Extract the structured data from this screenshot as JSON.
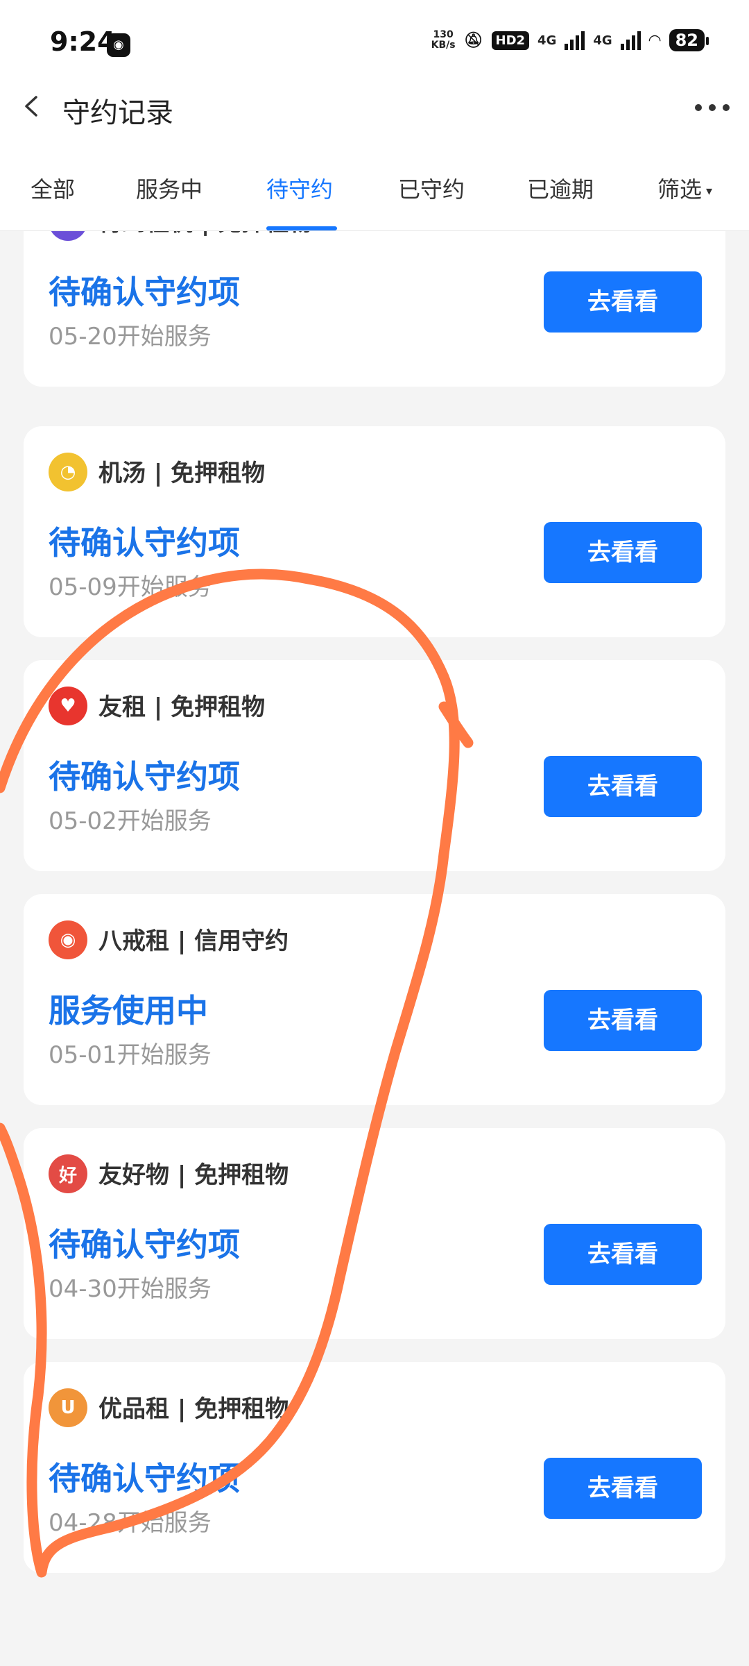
{
  "status_bar": {
    "time": "9:24",
    "speed_value": "130",
    "speed_unit": "KB/s",
    "hd_label": "HD2",
    "net1": "4G",
    "net2": "4G",
    "battery": "82"
  },
  "header": {
    "title": "守约记录"
  },
  "tabs": [
    {
      "label": "全部",
      "active": false
    },
    {
      "label": "服务中",
      "active": false
    },
    {
      "label": "待守约",
      "active": true
    },
    {
      "label": "已守约",
      "active": false
    },
    {
      "label": "已逾期",
      "active": false
    },
    {
      "label": "筛选",
      "active": false
    }
  ],
  "cards": [
    {
      "merchant": "待到租机 | 免押租物",
      "status": "待确认守约项",
      "date": "05-20开始服务",
      "button": "去看看",
      "logo_icon": "lightning-icon",
      "logo_glyph": "⚡",
      "logo_color": "#6b4fd8"
    },
    {
      "merchant": "机汤 | 免押租物",
      "status": "待确认守约项",
      "date": "05-09开始服务",
      "button": "去看看",
      "logo_icon": "chick-icon",
      "logo_glyph": "◔",
      "logo_color": "#f2c230"
    },
    {
      "merchant": "友租 | 免押租物",
      "status": "待确认守约项",
      "date": "05-02开始服务",
      "button": "去看看",
      "logo_icon": "rabbit-icon",
      "logo_glyph": "♥",
      "logo_color": "#e8352e"
    },
    {
      "merchant": "八戒租 | 信用守约",
      "status": "服务使用中",
      "date": "05-01开始服务",
      "button": "去看看",
      "logo_icon": "pig-icon",
      "logo_glyph": "◉",
      "logo_color": "#f0553a"
    },
    {
      "merchant": "友好物 | 免押租物",
      "status": "待确认守约项",
      "date": "04-30开始服务",
      "button": "去看看",
      "logo_icon": "hao-icon",
      "logo_glyph": "好",
      "logo_color": "#e34b45"
    },
    {
      "merchant": "优品租 | 免押租物",
      "status": "待确认守约项",
      "date": "04-28开始服务",
      "button": "去看看",
      "logo_icon": "u-icon",
      "logo_glyph": "U",
      "logo_color": "#f1953a"
    }
  ],
  "colors": {
    "accent": "#1677ff",
    "annotation": "#ff7a45"
  }
}
